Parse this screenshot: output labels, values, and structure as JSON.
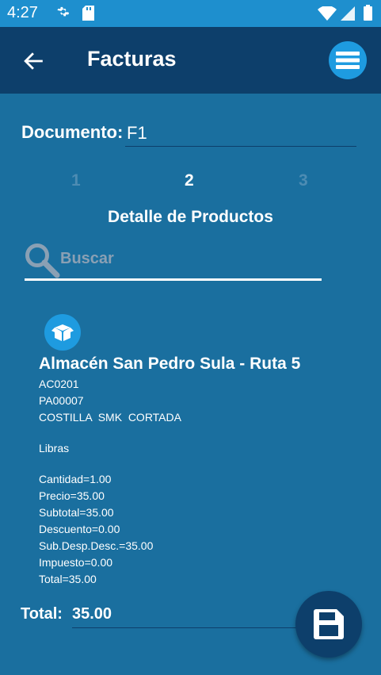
{
  "status_bar": {
    "time": "4:27"
  },
  "app_bar": {
    "title": "Facturas"
  },
  "document": {
    "label": "Documento:",
    "value": "F1"
  },
  "steps": [
    "1",
    "2",
    "3"
  ],
  "active_step": "2",
  "section_title": "Detalle de Productos",
  "search": {
    "placeholder": "Buscar",
    "value": ""
  },
  "product": {
    "warehouse": "Almacén San Pedro Sula - Ruta 5",
    "code1": "AC0201",
    "code2": "PA00007",
    "description": "COSTILLA  SMK  CORTADA",
    "unit": "Libras",
    "cantidad": "Cantidad=1.00",
    "precio": "Precio=35.00",
    "subtotal": "Subtotal=35.00",
    "descuento": "Descuento=0.00",
    "sub_desp_desc": "Sub.Desp.Desc.=35.00",
    "impuesto": "Impuesto=0.00",
    "total": "Total=35.00"
  },
  "total": {
    "label": "Total:",
    "value": "35.00"
  },
  "colors": {
    "status_bar": "#1e8fce",
    "app_bar": "#0d3f6b",
    "background": "#1a6f9f",
    "accent": "#1e9be0"
  }
}
